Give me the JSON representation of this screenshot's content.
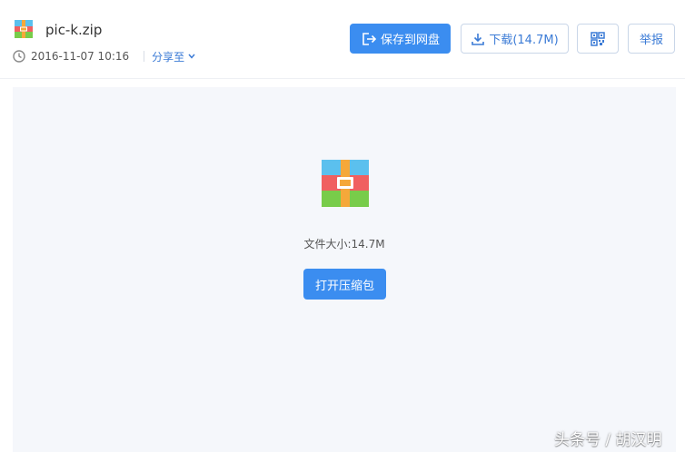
{
  "file": {
    "name": "pic-k.zip",
    "date": "2016-11-07 10:16",
    "share_label": "分享至",
    "size_text": "文件大小:14.7M"
  },
  "toolbar": {
    "save_label": "保存到网盘",
    "download_label": "下载(14.7M)",
    "report_label": "举报"
  },
  "preview": {
    "open_label": "打开压缩包"
  },
  "watermark": "头条号 / 胡汉明",
  "icons": {
    "file": "zip-archive-icon",
    "clock": "clock-icon",
    "share": "chevron-down-icon",
    "save": "save-to-disk-icon",
    "download": "download-icon",
    "qr": "qr-code-icon"
  },
  "colors": {
    "accent": "#3b8df0",
    "link": "#3b7bd6",
    "panel_bg": "#f5f7fb"
  }
}
